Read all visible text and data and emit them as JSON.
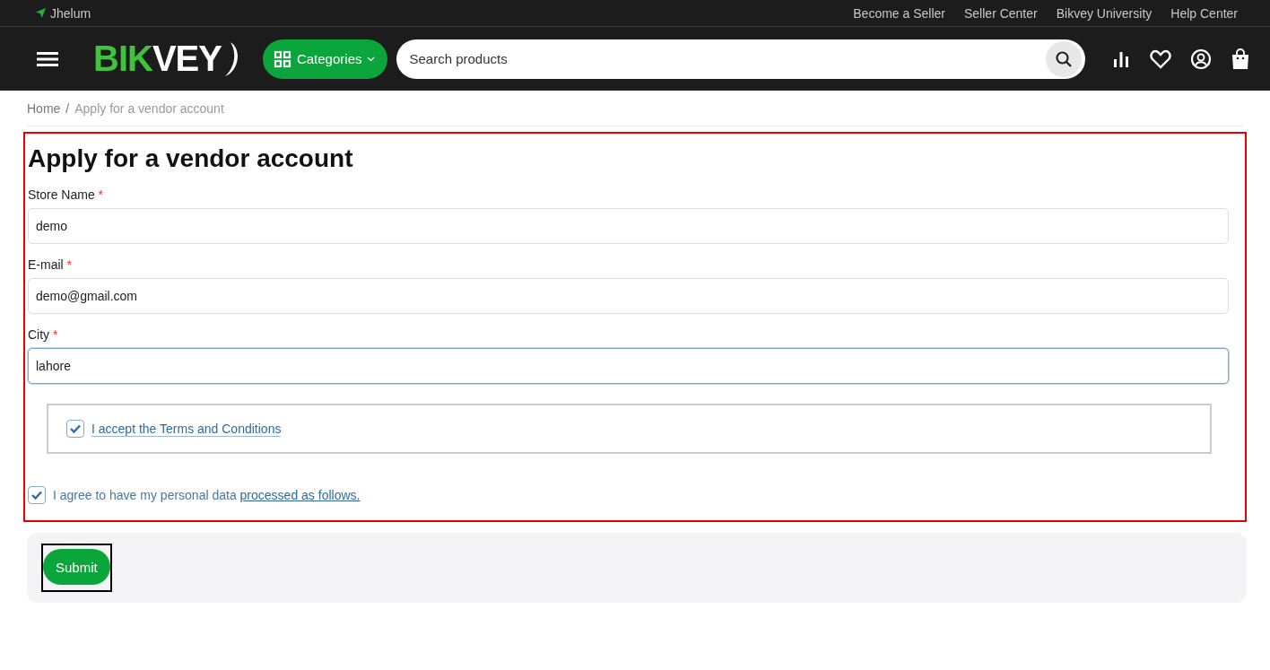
{
  "top_bar": {
    "location": "Jhelum",
    "links": [
      "Become a Seller",
      "Seller Center",
      "Bikvey University",
      "Help Center"
    ]
  },
  "header": {
    "logo": {
      "accent": "BIK",
      "rest": "VEY"
    },
    "categories_button": "Categories",
    "search": {
      "placeholder": "Search products"
    }
  },
  "breadcrumb": {
    "separator": "/",
    "items": [
      "Home",
      "Apply for a vendor account"
    ]
  },
  "form": {
    "title": "Apply for a vendor account",
    "fields": [
      {
        "label": "Store Name",
        "required_mark": "*",
        "value": "demo",
        "focused": false
      },
      {
        "label": "E-mail",
        "required_mark": "*",
        "value": "demo@gmail.com",
        "focused": false
      },
      {
        "label": "City",
        "required_mark": "*",
        "value": "lahore",
        "focused": true
      }
    ],
    "terms": {
      "label": "I accept the Terms and Conditions",
      "checked": true
    },
    "privacy": {
      "text": "I agree to have my personal data",
      "link": "processed as follows.",
      "checked": true
    }
  },
  "submit_button": "Submit"
}
